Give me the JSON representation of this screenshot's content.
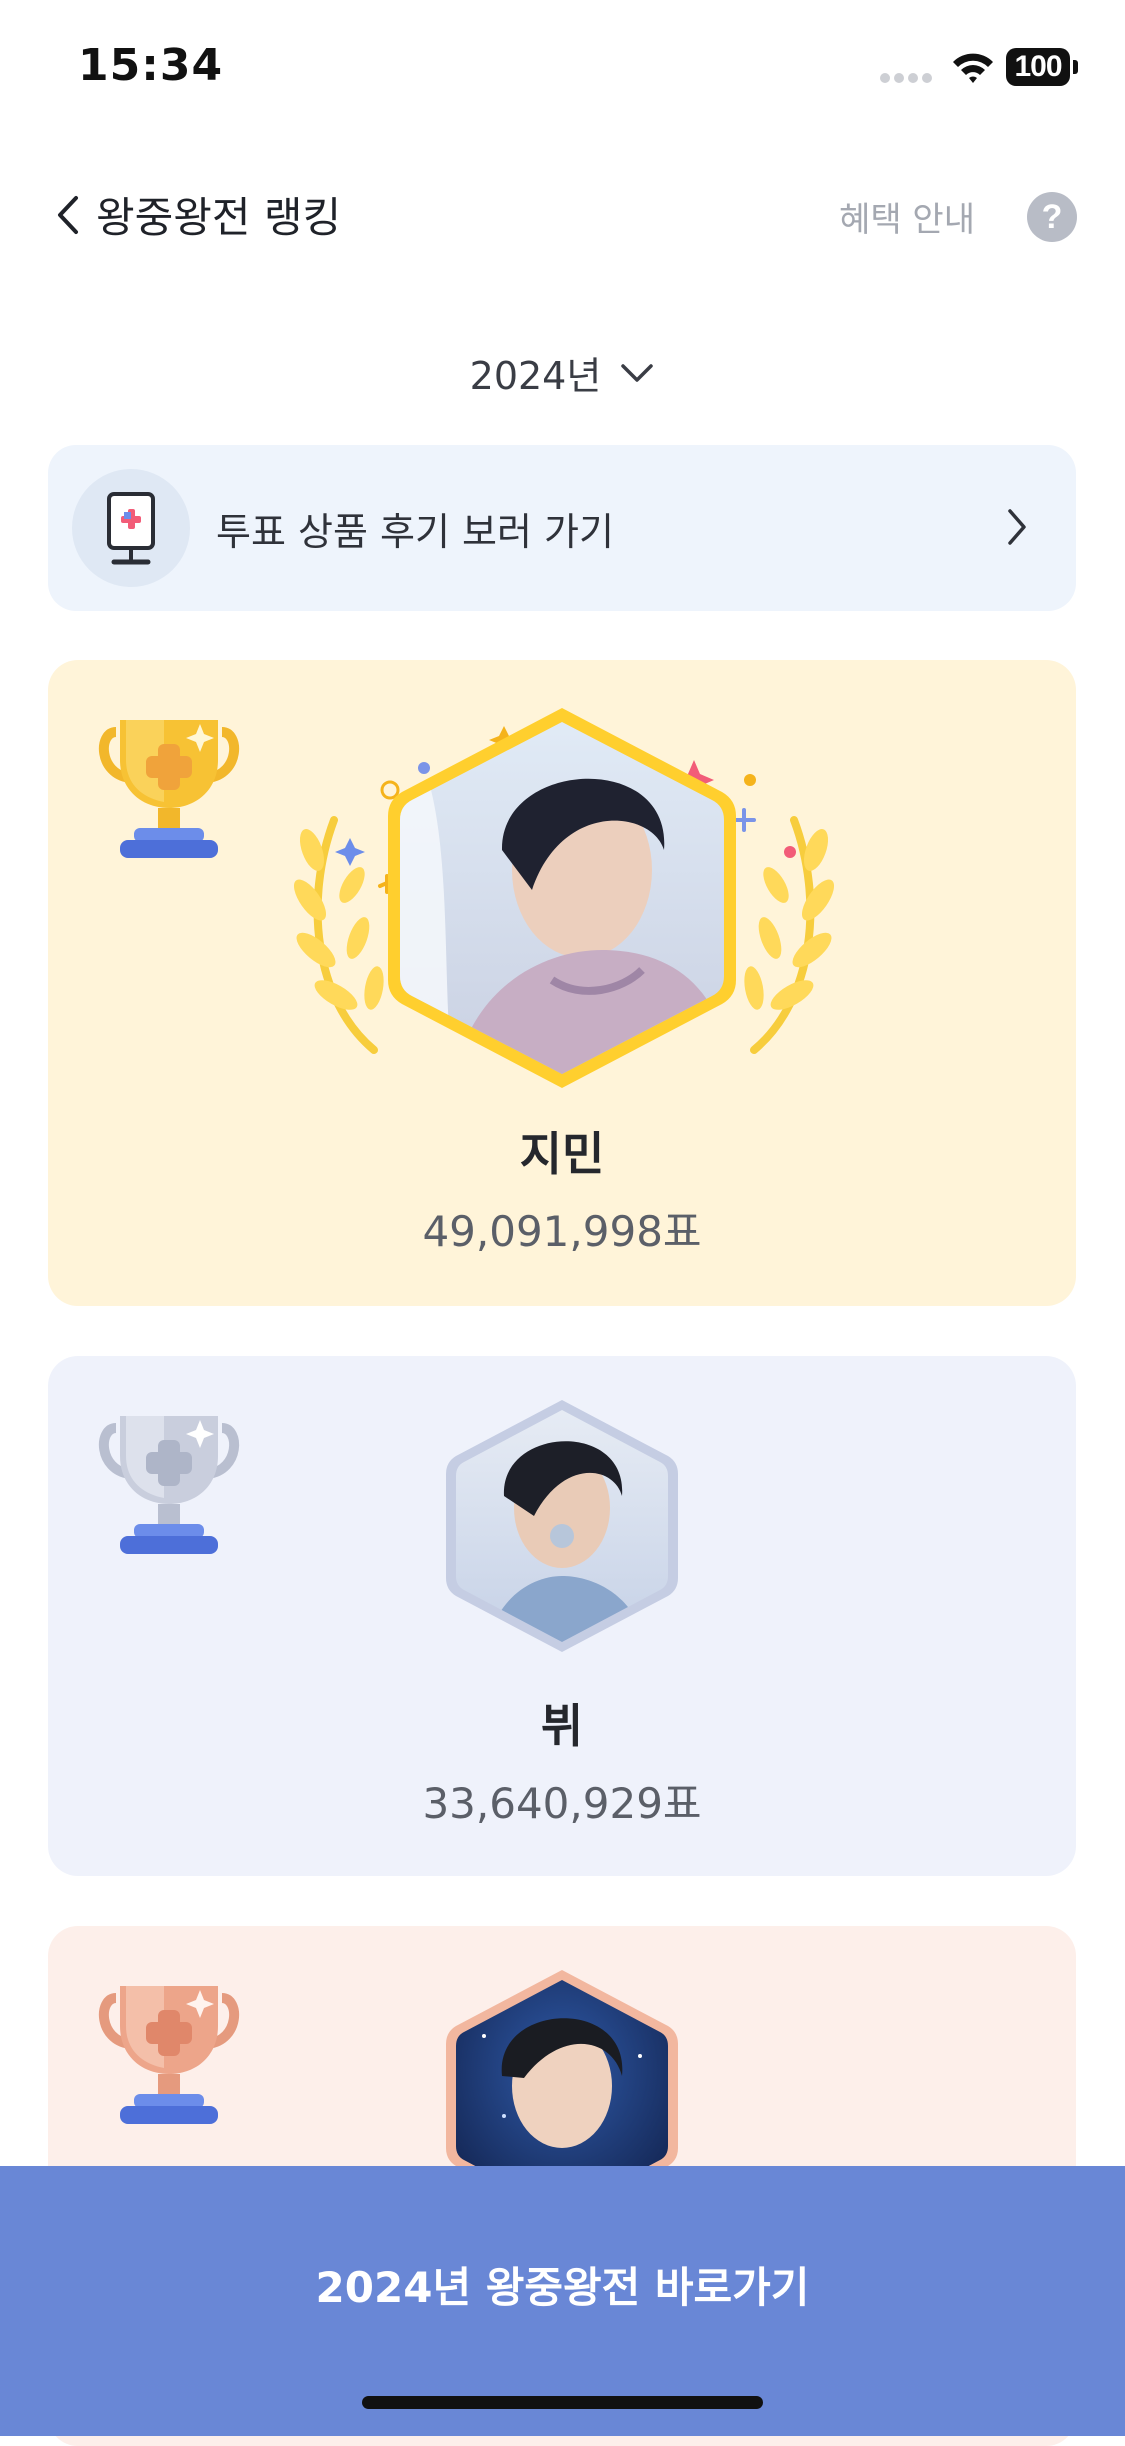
{
  "status_bar": {
    "time": "15:34",
    "battery": "100"
  },
  "header": {
    "back_label": "‹",
    "title": "왕중왕전 랭킹",
    "benefit_label": "혜택 안내",
    "help_label": "?"
  },
  "year_selector": {
    "label": "2024년"
  },
  "review_banner": {
    "label": "투표 상품 후기 보러 가기"
  },
  "ranking": [
    {
      "rank": 1,
      "medal": "gold",
      "name": "지민",
      "votes": "49,091,998표"
    },
    {
      "rank": 2,
      "medal": "silver",
      "name": "뷔",
      "votes": "33,640,929표"
    },
    {
      "rank": 3,
      "medal": "bronze"
    }
  ],
  "cta": {
    "label": "2024년 왕중왕전 바로가기"
  },
  "colors": {
    "gold_card": "#fff4d9",
    "silver_card": "#eff2fb",
    "bronze_card": "#fdefea",
    "cta": "#6987d6",
    "review_banner": "#eef4fc"
  },
  "icons": [
    "back-chevron-icon",
    "help-icon",
    "chevron-down-icon",
    "vote-product-icon",
    "chevron-right-icon",
    "gold-trophy-icon",
    "silver-trophy-icon",
    "bronze-trophy-icon",
    "laurel-icon",
    "sparkle-icon",
    "wifi-icon",
    "battery-icon",
    "signal-icon"
  ]
}
